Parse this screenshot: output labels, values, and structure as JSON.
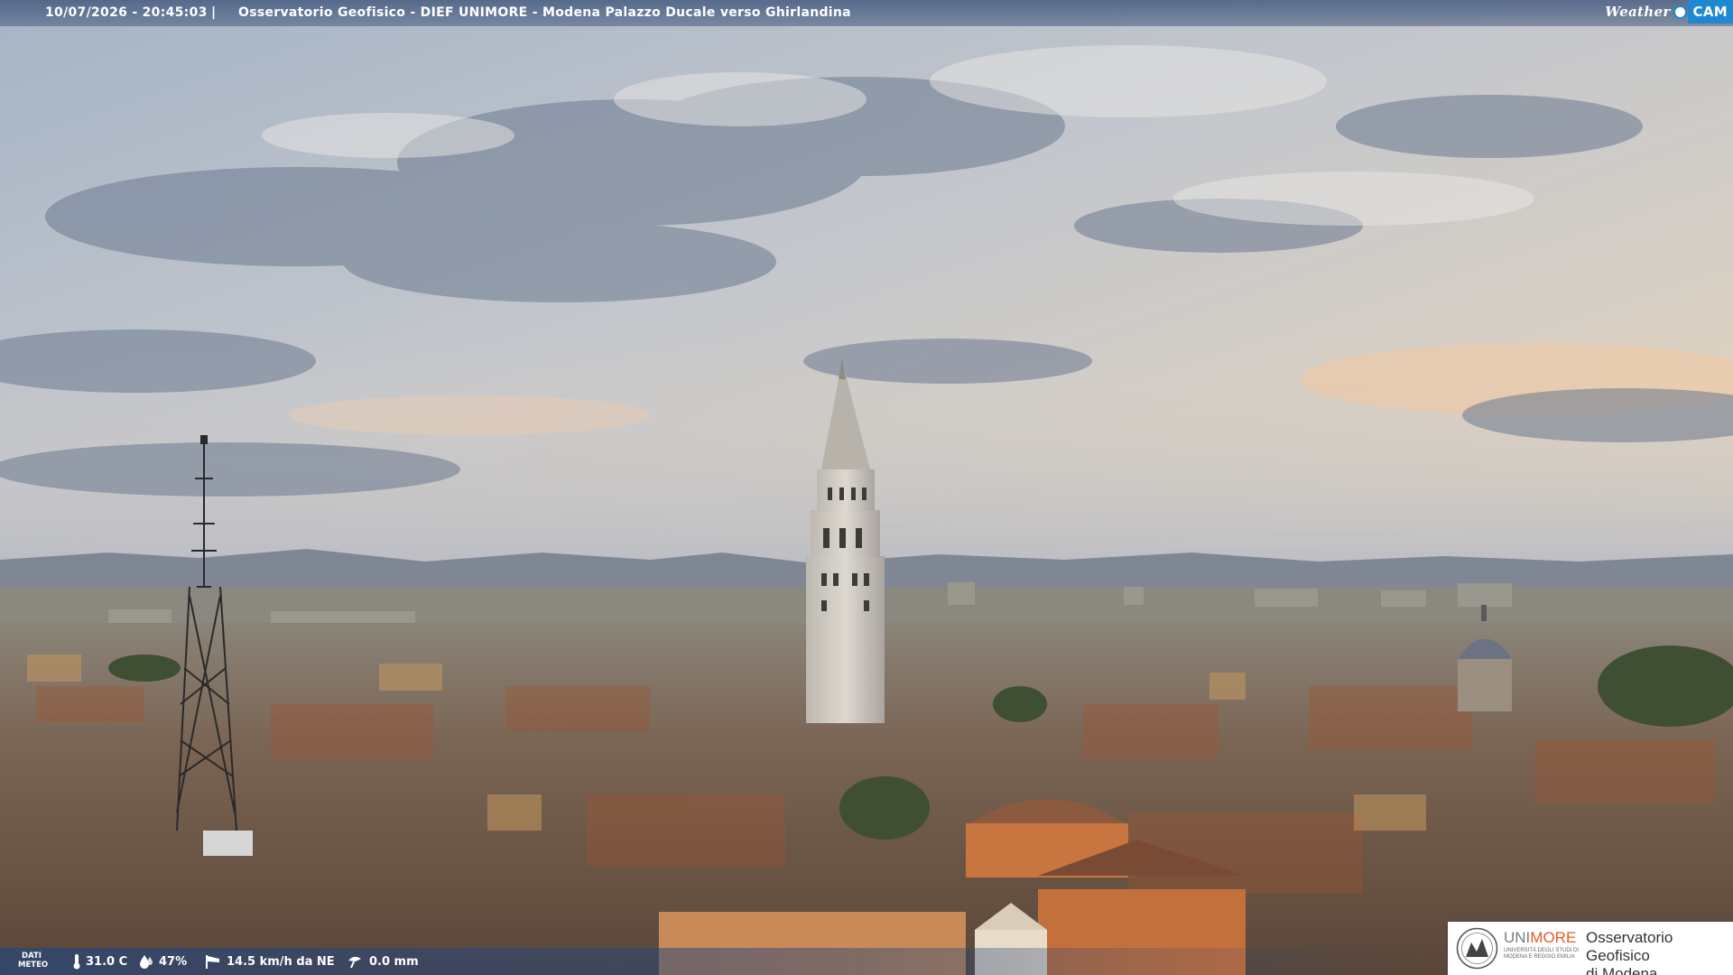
{
  "overlay": {
    "timestamp": "10/07/2026 - 20:45:03",
    "separator": "|",
    "title": "Osservatorio Geofisico - DIEF UNIMORE - Modena Palazzo Ducale verso Ghirlandina",
    "logo_weather": "Weather",
    "logo_cam": "CAM"
  },
  "meteo": {
    "label_line1": "DATI",
    "label_line2": "METEO",
    "temperature": "31.0 C",
    "humidity": "47%",
    "wind": "14.5 km/h da NE",
    "rain": "0.0 mm",
    "icons": [
      "thermometer-icon",
      "humidity-drop-icon",
      "wind-sock-icon",
      "rain-gauge-icon"
    ]
  },
  "branding": {
    "uni": "UNI",
    "more": "MORE",
    "subtitle": "UNIVERSITÀ DEGLI STUDI DI MODENA E REGGIO EMILIA",
    "observatory_line1": "Osservatorio Geofisico",
    "observatory_line2": "di Modena",
    "accent_color": "#e35b23"
  }
}
